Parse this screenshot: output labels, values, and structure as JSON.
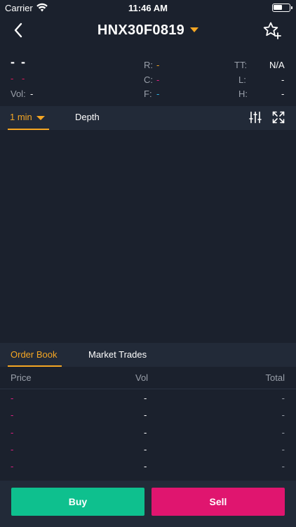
{
  "status_bar": {
    "carrier": "Carrier",
    "time": "11:46 AM",
    "wifi_icon": "wifi-icon",
    "battery_icon": "battery-icon"
  },
  "nav": {
    "title": "HNX30F0819",
    "back_icon": "back-chevron-icon",
    "favorite_icon": "star-plus-icon",
    "dropdown_icon": "caret-down-icon"
  },
  "info": {
    "price": "- -",
    "change": "- -",
    "vol_label": "Vol:",
    "vol_value": "-",
    "r_label": "R:",
    "r_value": "-",
    "c_label": "C:",
    "c_value": "-",
    "f_label": "F:",
    "f_value": "-",
    "tt_label": "TT:",
    "tt_value": "N/A",
    "l_label": "L:",
    "l_value": "-",
    "h_label": "H:",
    "h_value": "-"
  },
  "chart_tabs": {
    "interval": "1 min",
    "depth": "Depth",
    "settings_icon": "sliders-icon",
    "expand_icon": "expand-icon"
  },
  "order_tabs": {
    "order_book": "Order Book",
    "market_trades": "Market Trades"
  },
  "order_book": {
    "headers": {
      "price": "Price",
      "vol": "Vol",
      "total": "Total"
    },
    "rows": [
      {
        "price": "-",
        "vol": "-",
        "total": "-"
      },
      {
        "price": "-",
        "vol": "-",
        "total": "-"
      },
      {
        "price": "-",
        "vol": "-",
        "total": "-"
      },
      {
        "price": "-",
        "vol": "-",
        "total": "-"
      },
      {
        "price": "-",
        "vol": "-",
        "total": "-"
      }
    ]
  },
  "actions": {
    "buy": "Buy",
    "sell": "Sell"
  },
  "colors": {
    "accent": "#f5a623",
    "buy": "#0ec08e",
    "sell": "#e0156f",
    "background": "#1b212d",
    "panel": "#222a38"
  }
}
